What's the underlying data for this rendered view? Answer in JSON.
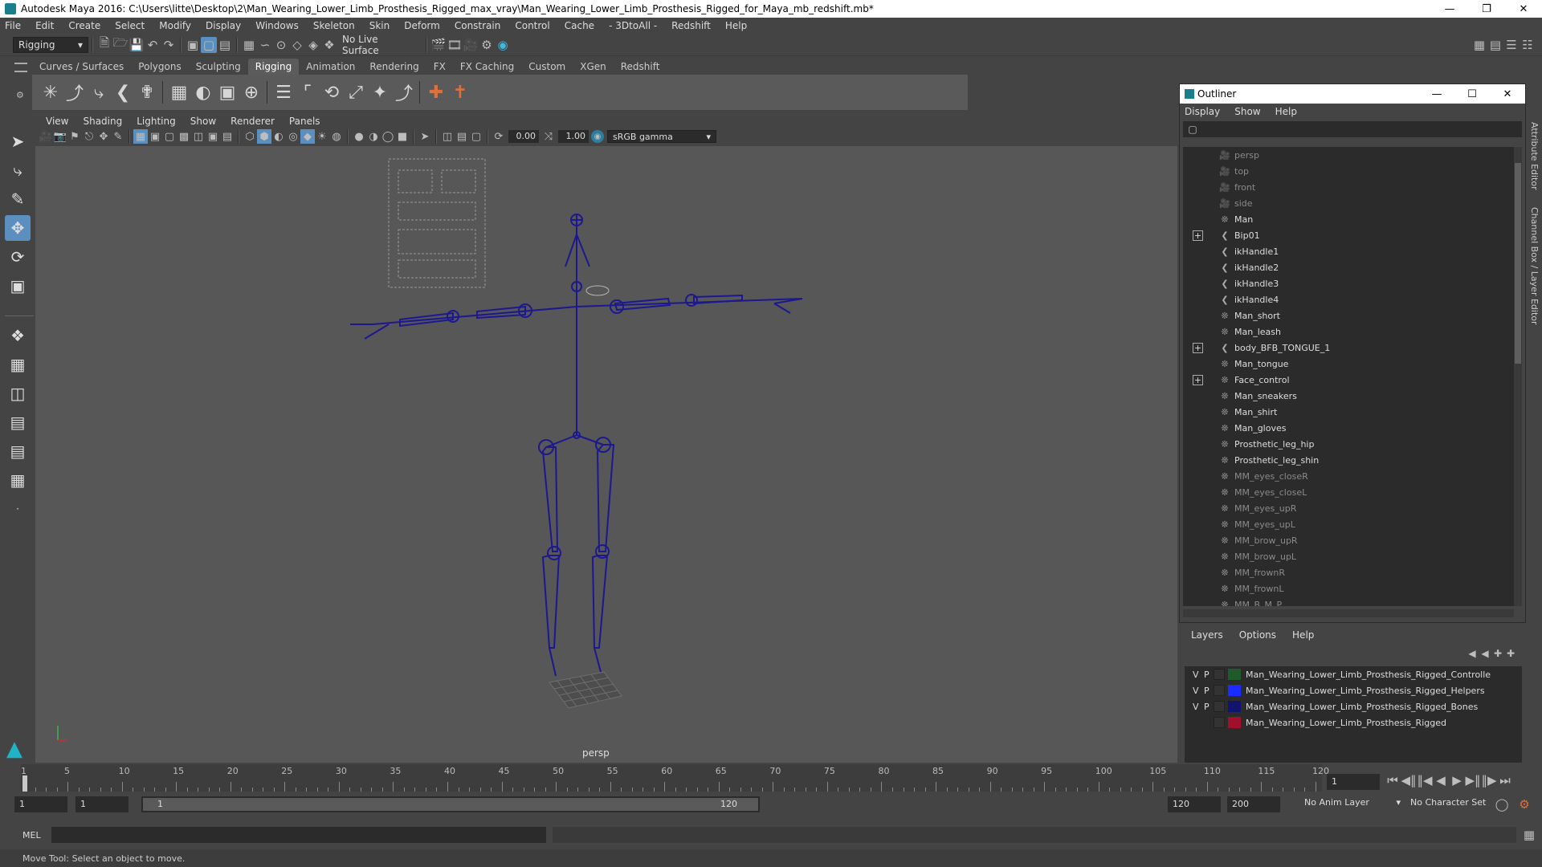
{
  "window": {
    "title": "Autodesk Maya 2016: C:\\Users\\litte\\Desktop\\2\\Man_Wearing_Lower_Limb_Prosthesis_Rigged_max_vray\\Man_Wearing_Lower_Limb_Prosthesis_Rigged_for_Maya_mb_redshift.mb*"
  },
  "menu": [
    "File",
    "Edit",
    "Create",
    "Select",
    "Modify",
    "Display",
    "Windows",
    "Skeleton",
    "Skin",
    "Deform",
    "Constrain",
    "Control",
    "Cache",
    "- 3DtoAll -",
    "Redshift",
    "Help"
  ],
  "status": {
    "mode": "Rigging",
    "live_surface": "No Live Surface"
  },
  "shelf_tabs": [
    "Curves / Surfaces",
    "Polygons",
    "Sculpting",
    "Rigging",
    "Animation",
    "Rendering",
    "FX",
    "FX Caching",
    "Custom",
    "XGen",
    "Redshift"
  ],
  "shelf_active": "Rigging",
  "viewport": {
    "menu": [
      "View",
      "Shading",
      "Lighting",
      "Show",
      "Renderer",
      "Panels"
    ],
    "exposure": "0.00",
    "gamma": "1.00",
    "color_space": "sRGB gamma",
    "camera_label": "persp"
  },
  "outliner": {
    "title": "Outliner",
    "menu": [
      "Display",
      "Show",
      "Help"
    ],
    "items": [
      {
        "name": "persp",
        "icon": "camera-icon",
        "dim": true,
        "expand": false
      },
      {
        "name": "top",
        "icon": "camera-icon",
        "dim": true,
        "expand": false
      },
      {
        "name": "front",
        "icon": "camera-icon",
        "dim": true,
        "expand": false
      },
      {
        "name": "side",
        "icon": "camera-icon",
        "dim": true,
        "expand": false
      },
      {
        "name": "Man",
        "icon": "mesh-icon",
        "dim": false,
        "expand": false
      },
      {
        "name": "Bip01",
        "icon": "joint-icon",
        "dim": false,
        "expand": true
      },
      {
        "name": "ikHandle1",
        "icon": "ik-icon",
        "dim": false,
        "expand": false
      },
      {
        "name": "ikHandle2",
        "icon": "ik-icon",
        "dim": false,
        "expand": false
      },
      {
        "name": "ikHandle3",
        "icon": "ik-icon",
        "dim": false,
        "expand": false
      },
      {
        "name": "ikHandle4",
        "icon": "ik-icon",
        "dim": false,
        "expand": false
      },
      {
        "name": "Man_short",
        "icon": "mesh-icon",
        "dim": false,
        "expand": false
      },
      {
        "name": "Man_leash",
        "icon": "mesh-icon",
        "dim": false,
        "expand": false
      },
      {
        "name": "body_BFB_TONGUE_1",
        "icon": "joint-icon",
        "dim": false,
        "expand": true
      },
      {
        "name": "Man_tongue",
        "icon": "mesh-icon",
        "dim": false,
        "expand": false
      },
      {
        "name": "Face_control",
        "icon": "mesh-icon",
        "dim": false,
        "expand": true
      },
      {
        "name": "Man_sneakers",
        "icon": "mesh-icon",
        "dim": false,
        "expand": false
      },
      {
        "name": "Man_shirt",
        "icon": "mesh-icon",
        "dim": false,
        "expand": false
      },
      {
        "name": "Man_gloves",
        "icon": "mesh-icon",
        "dim": false,
        "expand": false
      },
      {
        "name": "Prosthetic_leg_hip",
        "icon": "mesh-icon",
        "dim": false,
        "expand": false
      },
      {
        "name": "Prosthetic_leg_shin",
        "icon": "mesh-icon",
        "dim": false,
        "expand": false
      },
      {
        "name": "MM_eyes_closeR",
        "icon": "mesh-icon",
        "dim": true,
        "expand": false
      },
      {
        "name": "MM_eyes_closeL",
        "icon": "mesh-icon",
        "dim": true,
        "expand": false
      },
      {
        "name": "MM_eyes_upR",
        "icon": "mesh-icon",
        "dim": true,
        "expand": false
      },
      {
        "name": "MM_eyes_upL",
        "icon": "mesh-icon",
        "dim": true,
        "expand": false
      },
      {
        "name": "MM_brow_upR",
        "icon": "mesh-icon",
        "dim": true,
        "expand": false
      },
      {
        "name": "MM_brow_upL",
        "icon": "mesh-icon",
        "dim": true,
        "expand": false
      },
      {
        "name": "MM_frownR",
        "icon": "mesh-icon",
        "dim": true,
        "expand": false
      },
      {
        "name": "MM_frownL",
        "icon": "mesh-icon",
        "dim": true,
        "expand": false
      },
      {
        "name": "MM_B_M_P",
        "icon": "mesh-icon",
        "dim": true,
        "expand": false
      }
    ]
  },
  "layers": {
    "menu": [
      "Layers",
      "Options",
      "Help"
    ],
    "items": [
      {
        "v": "V",
        "p": "P",
        "color": "#1f5a2a",
        "name": "Man_Wearing_Lower_Limb_Prosthesis_Rigged_Controlle"
      },
      {
        "v": "V",
        "p": "P",
        "color": "#1a2cff",
        "name": "Man_Wearing_Lower_Limb_Prosthesis_Rigged_Helpers"
      },
      {
        "v": "V",
        "p": "P",
        "color": "#11146e",
        "name": "Man_Wearing_Lower_Limb_Prosthesis_Rigged_Bones"
      },
      {
        "v": "",
        "p": "",
        "color": "#a0102a",
        "name": "Man_Wearing_Lower_Limb_Prosthesis_Rigged"
      }
    ]
  },
  "side_tabs": [
    "Attribute Editor",
    "Channel Box / Layer Editor"
  ],
  "timeline": {
    "ticks": [
      "1",
      "5",
      "10",
      "15",
      "20",
      "25",
      "30",
      "35",
      "40",
      "45",
      "50",
      "55",
      "60",
      "65",
      "70",
      "75",
      "80",
      "85",
      "90",
      "95",
      "100",
      "105",
      "110",
      "115",
      "120"
    ],
    "current_frame": "1",
    "range_start": "1",
    "range_inner_start": "1",
    "slider_start": "1",
    "slider_end": "120",
    "range_end": "120",
    "anim_end": "200",
    "anim_layer": "No Anim Layer",
    "character_set": "No Character Set"
  },
  "command": {
    "label": "MEL"
  },
  "help_line": "Move Tool: Select an object to move."
}
